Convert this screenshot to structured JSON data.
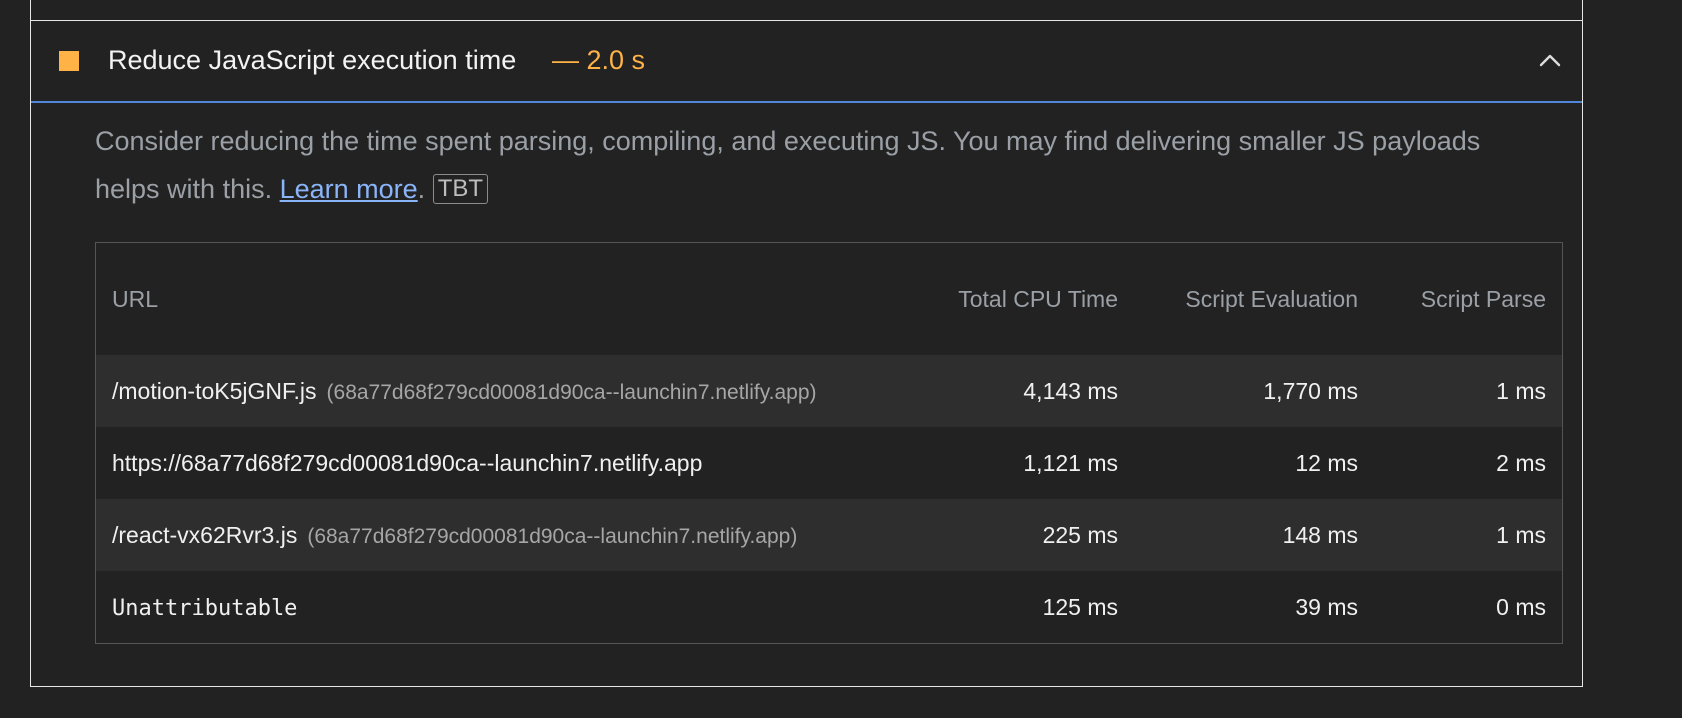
{
  "audit": {
    "title": "Reduce JavaScript execution time",
    "value": "— 2.0 s",
    "status_color": "#ffb347",
    "description_before": "Consider reducing the time spent parsing, compiling, and executing JS. You may find delivering smaller JS payloads helps with this. ",
    "learn_more": "Learn more",
    "description_after": ".",
    "tbt_badge": "TBT"
  },
  "table": {
    "headers": {
      "url": "URL",
      "total_cpu_time": "Total CPU Time",
      "script_evaluation": "Script Evaluation",
      "script_parse": "Script Parse"
    },
    "rows": [
      {
        "url": "/motion-toK5jGNF.js",
        "host": "(68a77d68f279cd00081d90ca--launchin7.netlify.app)",
        "total_cpu_time": "4,143 ms",
        "script_evaluation": "1,770 ms",
        "script_parse": "1 ms"
      },
      {
        "url": "https://68a77d68f279cd00081d90ca--launchin7.netlify.app",
        "host": "",
        "total_cpu_time": "1,121 ms",
        "script_evaluation": "12 ms",
        "script_parse": "2 ms"
      },
      {
        "url": "/react-vx62Rvr3.js",
        "host": "(68a77d68f279cd00081d90ca--launchin7.netlify.app)",
        "total_cpu_time": "225 ms",
        "script_evaluation": "148 ms",
        "script_parse": "1 ms"
      },
      {
        "url": "Unattributable",
        "host": "",
        "total_cpu_time": "125 ms",
        "script_evaluation": "39 ms",
        "script_parse": "0 ms"
      }
    ]
  },
  "icons": {
    "status": "average-square-icon",
    "toggle": "chevron-up-icon"
  }
}
